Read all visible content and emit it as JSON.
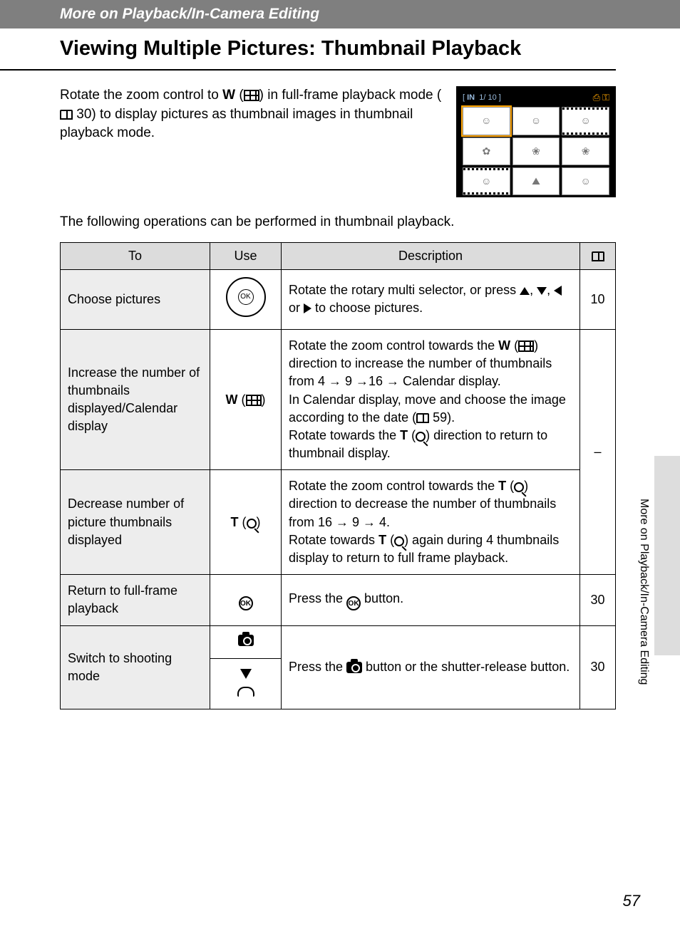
{
  "header": "More on Playback/In-Camera Editing",
  "title": "Viewing Multiple Pictures: Thumbnail Playback",
  "intro1_a": "Rotate the zoom control to ",
  "intro1_w": "W",
  "intro1_b": " (",
  "intro1_c": ") in full-frame playback mode (",
  "intro1_ref": " 30) to display pictures as thumbnail images in thumbnail playback mode.",
  "preview": {
    "in": "IN",
    "count": "1/   10"
  },
  "intro2": "The following operations can be performed in thumbnail playback.",
  "cols": {
    "to": "To",
    "use": "Use",
    "desc": "Description"
  },
  "rows": {
    "r1": {
      "to": "Choose pictures",
      "desc_a": "Rotate the rotary multi selector, or press ",
      "desc_b": ", ",
      "desc_c": ", ",
      "desc_d": " or ",
      "desc_e": " to choose pictures.",
      "ref": "10"
    },
    "r2": {
      "to": "Increase the number of thumbnails displayed/Calendar display",
      "use_w": "W",
      "desc_a": "Rotate the zoom control towards the ",
      "desc_b": " (",
      "desc_c": ") direction to increase the number of thumbnails from 4 → 9 →16 → Calendar display.",
      "desc_d": "In Calendar display, move and choose the image according to the date (",
      "desc_e": " 59).",
      "desc_f": "Rotate towards the ",
      "desc_t": "T",
      "desc_g": " (",
      "desc_h": ") direction to return to thumbnail display."
    },
    "r3": {
      "to": "Decrease number of picture thumbnails displayed",
      "use_t": "T",
      "desc_a": "Rotate the zoom control towards the ",
      "desc_b": " (",
      "desc_c": ") direction to decrease the number of thumbnails from 16 → 9 → 4.",
      "desc_d": "Rotate towards ",
      "desc_e": " (",
      "desc_f": ") again during 4 thumbnails display to return to full frame playback."
    },
    "r23_ref": "–",
    "r4": {
      "to": "Return to full-frame playback",
      "desc_a": "Press the ",
      "desc_b": " button.",
      "ref": "30"
    },
    "r5": {
      "to": "Switch to shooting mode",
      "desc_a": "Press the ",
      "desc_b": " button or the shutter-release button.",
      "ref": "30"
    }
  },
  "sideLabel": "More on Playback/In-Camera Editing",
  "pageNum": "57"
}
